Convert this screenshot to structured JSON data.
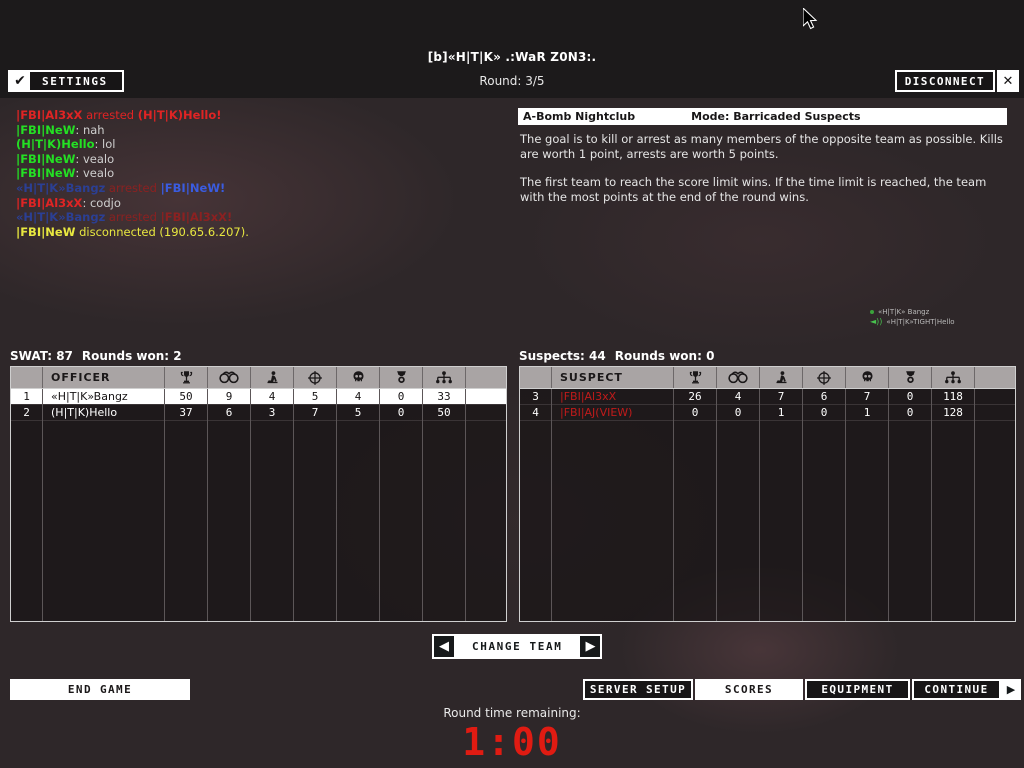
{
  "header": {
    "title": "[b]«H|T|K» .:WaR Z0N3:.",
    "round": "Round: 3/5",
    "settings_label": "SETTINGS",
    "settings_check": "✔",
    "disconnect_label": "DISCONNECT",
    "close_label": "✕"
  },
  "chat": {
    "lines": [
      {
        "name": "|FBI|Al3xX",
        "name_class": "c-red",
        "msg": " arrested ",
        "msg_class": "c-red",
        "tail": "(H|T|K)Hello!",
        "tail_class": "c-red"
      },
      {
        "name": "|FBI|NeW",
        "name_class": "c-green",
        "msg": ": nah",
        "msg_class": "c-msg",
        "tail": "",
        "tail_class": ""
      },
      {
        "name": "(H|T|K)Hello",
        "name_class": "c-green",
        "msg": ": lol",
        "msg_class": "c-msg",
        "tail": "",
        "tail_class": ""
      },
      {
        "name": "|FBI|NeW",
        "name_class": "c-green",
        "msg": ": vealo",
        "msg_class": "c-msg",
        "tail": "",
        "tail_class": ""
      },
      {
        "name": "|FBI|NeW",
        "name_class": "c-green",
        "msg": ": vealo",
        "msg_class": "c-msg",
        "tail": "",
        "tail_class": ""
      },
      {
        "name": "«H|T|K»Bangz",
        "name_class": "c-dim-blue",
        "msg": " arrested ",
        "msg_class": "c-dim-red",
        "tail": "|FBI|NeW!",
        "tail_class": "c-blue"
      },
      {
        "name": "|FBI|Al3xX",
        "name_class": "c-red",
        "msg": ": codjo",
        "msg_class": "c-msg",
        "tail": "",
        "tail_class": ""
      },
      {
        "name": "«H|T|K»Bangz",
        "name_class": "c-dim-blue",
        "msg": " arrested ",
        "msg_class": "c-dim-red",
        "tail": "|FBI|Al3xX!",
        "tail_class": "c-dim-red"
      },
      {
        "name": "|FBI|NeW",
        "name_class": "c-yellow",
        "msg": " disconnected (190.65.6.207).",
        "msg_class": "c-yellow",
        "tail": "",
        "tail_class": ""
      }
    ]
  },
  "briefing": {
    "map": "A-Bomb Nightclub",
    "mode": "Mode: Barricaded Suspects",
    "para1": "The goal is to kill or arrest as many members of the opposite team as possible.  Kills are worth 1 point, arrests are worth 5 points.",
    "para2": "The first team to reach the score limit wins.  If the time limit is reached, the team with the most points at the end of the round wins."
  },
  "voice": {
    "rows": [
      {
        "name": "«H|T|K» Bangz",
        "icon": "status-dot-icon"
      },
      {
        "name": "«H|T|K»TIGHT|Hello",
        "icon": "speaker-icon"
      }
    ]
  },
  "swat": {
    "score_label": "SWAT: 87",
    "rounds_label": "Rounds won: 2",
    "col_name": "OFFICER",
    "icons": [
      "trophy-icon",
      "handcuffs-icon",
      "arrest-icon",
      "crosshair-icon",
      "skull-icon",
      "medal-icon",
      "ping-icon"
    ],
    "rows": [
      {
        "rank": "1",
        "name": "«H|T|K»Bangz",
        "stats": [
          "50",
          "9",
          "4",
          "5",
          "4",
          "0",
          "33"
        ],
        "selected": true
      },
      {
        "rank": "2",
        "name": "(H|T|K)Hello",
        "stats": [
          "37",
          "6",
          "3",
          "7",
          "5",
          "0",
          "50"
        ],
        "selected": false
      }
    ]
  },
  "suspects": {
    "score_label": "Suspects: 44",
    "rounds_label": "Rounds won: 0",
    "col_name": "SUSPECT",
    "icons": [
      "trophy-icon",
      "handcuffs-icon",
      "arrest-icon",
      "crosshair-icon",
      "skull-icon",
      "medal-icon",
      "ping-icon"
    ],
    "rows": [
      {
        "rank": "3",
        "name": "|FBI|Al3xX",
        "stats": [
          "26",
          "4",
          "7",
          "6",
          "7",
          "0",
          "118"
        ],
        "selected": false
      },
      {
        "rank": "4",
        "name": "|FBI|AJ(VIEW)",
        "stats": [
          "0",
          "0",
          "1",
          "0",
          "1",
          "0",
          "128"
        ],
        "selected": false
      }
    ]
  },
  "controls": {
    "change_team": "CHANGE TEAM",
    "left_arrow": "◀",
    "right_arrow": "▶",
    "end_game": "END GAME",
    "server_setup": "SERVER SETUP",
    "scores": "SCORES",
    "equipment": "EQUIPMENT",
    "continue": "CONTINUE",
    "continue_arrow": "▶"
  },
  "timer": {
    "label": "Round time remaining:",
    "value": "1:00",
    "color": "#e01b12"
  }
}
